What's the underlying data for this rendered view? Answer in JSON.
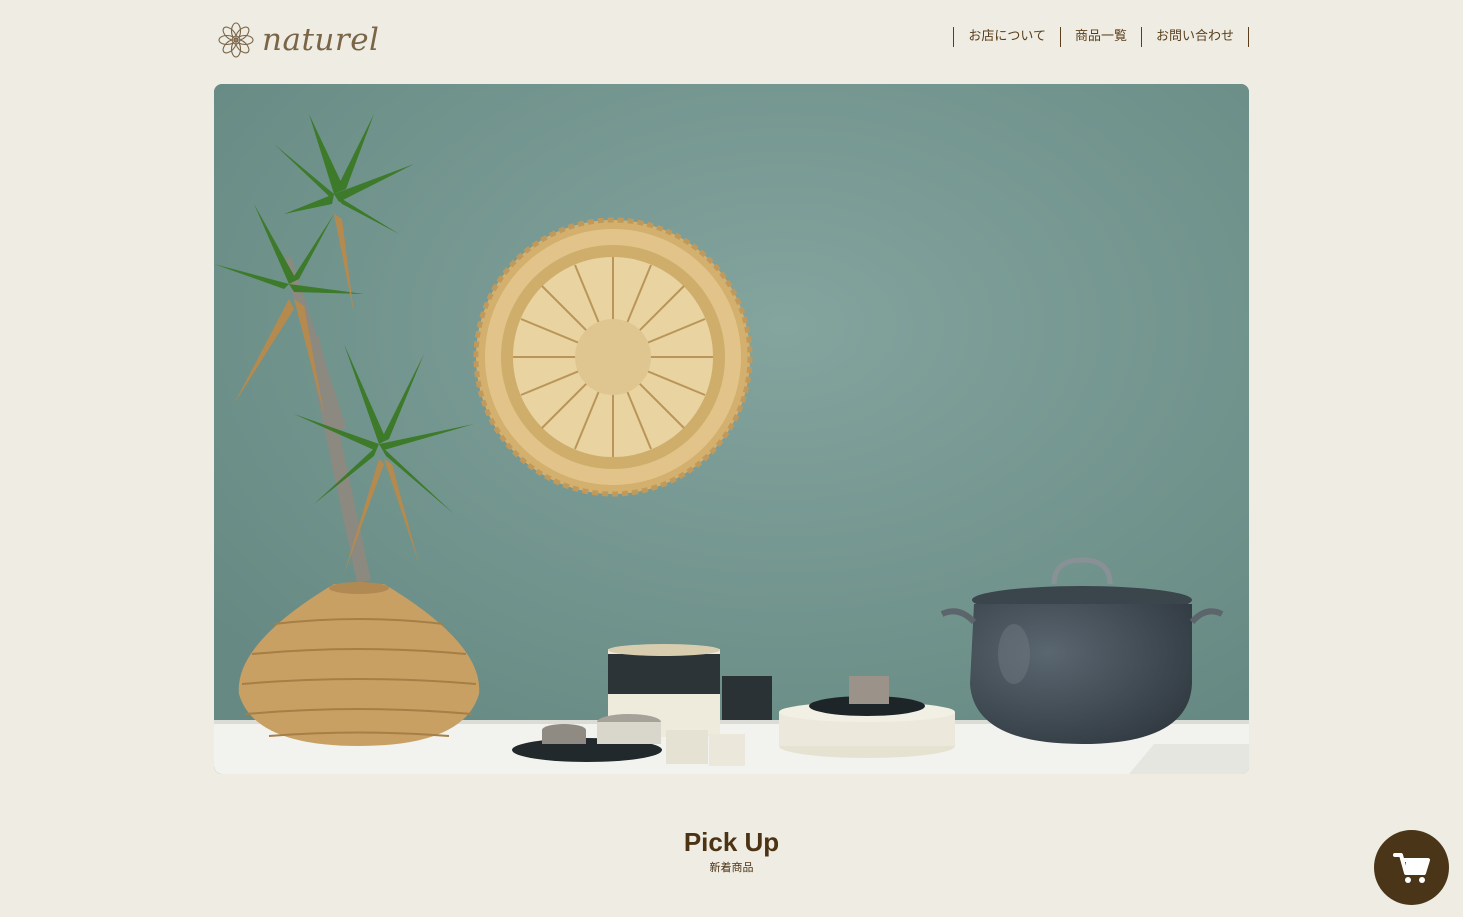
{
  "header": {
    "logo_text": "naturel",
    "logo_icon": "mandala-flower-icon",
    "nav": [
      {
        "label": "お店について"
      },
      {
        "label": "商品一覧"
      },
      {
        "label": "お問い合わせ"
      }
    ]
  },
  "hero": {
    "image": "green wall with wicker wall plate, potted yucca in rattan basket, tableware and dark cooking pot on white counter"
  },
  "section": {
    "title": "Pick Up",
    "subtitle": "新着商品"
  },
  "cart": {
    "icon": "cart-icon"
  },
  "colors": {
    "background": "#eeece3",
    "text": "#5a3f1c",
    "cart_button": "#4a3519",
    "hero_wall": "#6e928b"
  }
}
